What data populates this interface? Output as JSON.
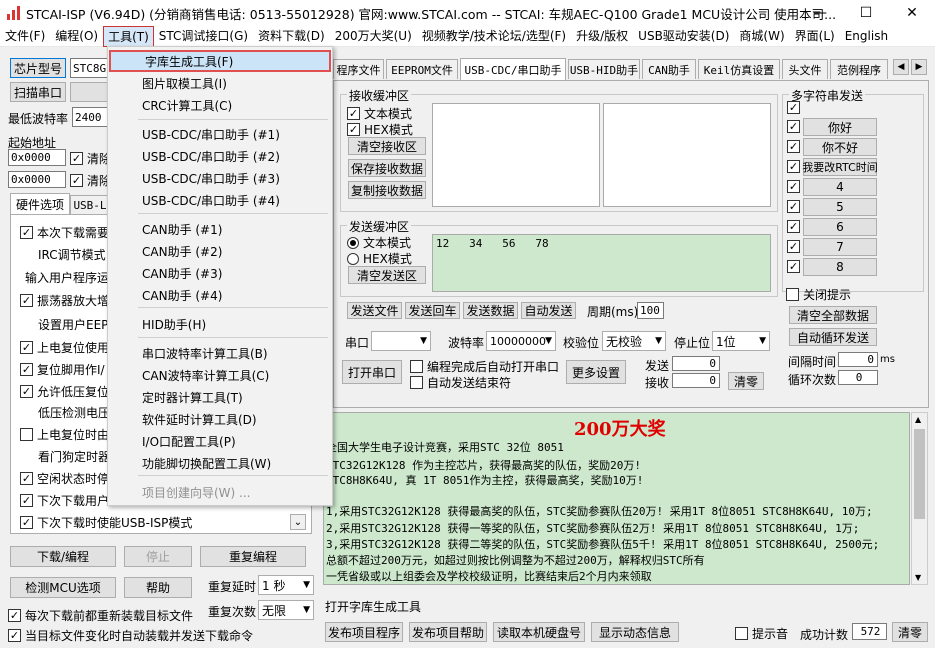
{
  "window": {
    "title": "STCAI-ISP (V6.94D) (分销商销售电话: 0513-55012928) 官网:www.STCAI.com  -- STCAI: 车规AEC-Q100 Grade1 MCU设计公司 使用本司...",
    "min": "—",
    "max": "☐",
    "close": "✕"
  },
  "menu": [
    "文件(F)",
    "编程(O)",
    "工具(T)",
    "STC调试接口(G)",
    "资料下载(D)",
    "200万大奖(U)",
    "视频教学/技术论坛/选型(F)",
    "升级/版权",
    "USB驱动安装(D)",
    "商城(W)",
    "界面(L)",
    "English"
  ],
  "left": {
    "chip_btn": "芯片型号",
    "chip_val": "STC8G",
    "scan_btn": "扫描串口",
    "min_baud_label": "最低波特率",
    "min_baud_val": "2400",
    "start_addr_label": "起始地址",
    "addr1": "0x0000",
    "clear1": "清除",
    "addr2": "0x0000",
    "clear2": "清除",
    "hw_tab": "硬件选项",
    "usb_tab": "USB-L",
    "options": [
      {
        "checked": true,
        "text": "本次下载需要"
      },
      {
        "checked": null,
        "text": "IRC调节模式"
      },
      {
        "checked": null,
        "text": "输入用户程序运"
      },
      {
        "checked": true,
        "text": "振荡器放大增"
      },
      {
        "checked": null,
        "text": "设置用户EEPR"
      },
      {
        "checked": true,
        "text": "上电复位使用"
      },
      {
        "checked": true,
        "text": "复位脚用作I/"
      },
      {
        "checked": true,
        "text": "允许低压复位"
      },
      {
        "checked": null,
        "text": "低压检测电压"
      },
      {
        "checked": false,
        "text": "上电复位时由"
      },
      {
        "checked": null,
        "text": "看门狗定时器"
      },
      {
        "checked": true,
        "text": "空闲状态时停"
      },
      {
        "checked": true,
        "text": "下次下载用户"
      },
      {
        "checked": true,
        "text": "下次下载时使能USB-ISP模式"
      }
    ],
    "download_btn": "下载/编程",
    "stop_btn": "停止",
    "reprogram_btn": "重复编程",
    "detect_btn": "检测MCU选项",
    "help_btn": "帮助",
    "repeat_delay_label": "重复延时",
    "repeat_delay_val": "1 秒",
    "repeat_count_label": "重复次数",
    "repeat_count_val": "无限",
    "reload_label": "每次下载前都重新装载目标文件",
    "auto_label": "当目标文件变化时自动装载并发送下载命令"
  },
  "dropdown": {
    "items": [
      {
        "label": "字库生成工具(F)",
        "highlight": true
      },
      {
        "label": "图片取模工具(I)"
      },
      {
        "label": "CRC计算工具(C)"
      },
      {
        "label": "USB-CDC/串口助手 (#1)"
      },
      {
        "label": "USB-CDC/串口助手 (#2)"
      },
      {
        "label": "USB-CDC/串口助手 (#3)"
      },
      {
        "label": "USB-CDC/串口助手 (#4)"
      },
      {
        "label": "CAN助手 (#1)"
      },
      {
        "label": "CAN助手 (#2)"
      },
      {
        "label": "CAN助手 (#3)"
      },
      {
        "label": "CAN助手 (#4)"
      },
      {
        "label": "HID助手(H)"
      },
      {
        "label": "串口波特率计算工具(B)"
      },
      {
        "label": "CAN波特率计算工具(C)"
      },
      {
        "label": "定时器计算工具(T)"
      },
      {
        "label": "软件延时计算工具(D)"
      },
      {
        "label": "I/O口配置工具(P)"
      },
      {
        "label": "功能脚切换配置工具(W)"
      },
      {
        "label": "项目创建向导(W) ...",
        "disabled": true
      }
    ]
  },
  "tabs": [
    "程序文件",
    "EEPROM文件",
    "USB-CDC/串口助手",
    "USB-HID助手",
    "CAN助手",
    "Keil仿真设置",
    "头文件",
    "范例程序"
  ],
  "serial": {
    "recv_group": "接收缓冲区",
    "text_mode": "文本模式",
    "hex_mode": "HEX模式",
    "clear_recv": "清空接收区",
    "save_recv": "保存接收数据",
    "copy_recv": "复制接收数据",
    "send_group": "发送缓冲区",
    "send_text_mode": "文本模式",
    "send_hex_mode": "HEX模式",
    "clear_send": "清空发送区",
    "send_content": "12   34   56   78",
    "send_file": "发送文件",
    "send_back": "发送回车",
    "send_data": "发送数据",
    "auto_send": "自动发送",
    "period_label": "周期(ms)",
    "period_val": "100",
    "port_label": "串口",
    "baud_label": "波特率",
    "baud_val": "10000000",
    "parity_label": "校验位",
    "parity_val": "无校验",
    "stop_label": "停止位",
    "stop_val": "1位",
    "open_port": "打开串口",
    "auto_open": "编程完成后自动打开串口",
    "auto_end": "自动发送结束符",
    "more_settings": "更多设置",
    "sent_label": "发送",
    "sent_val": "0",
    "recv_label": "接收",
    "recv_val": "0",
    "clear_count": "清零"
  },
  "multi": {
    "title": "多字符串发送",
    "items": [
      "你好",
      "你不好",
      "我要改RTC时间",
      "4",
      "5",
      "6",
      "7",
      "8"
    ],
    "close_hint": "关闭提示",
    "clear_all": "清空全部数据",
    "auto_loop": "自动循环发送",
    "interval_label": "间隔时间",
    "interval_val": "0",
    "interval_unit": "ms",
    "loop_label": "循环次数",
    "loop_val": "0"
  },
  "news": {
    "title": "200万大奖",
    "lines": [
      "全国大学生电子设计竞赛，采用STC 32位 8051",
      "STC32G12K128 作为主控芯片，获得最高奖的队伍，奖励20万!",
      "STC8H8K64U, 真 1T 8051作为主控，获得最高奖，奖励10万!",
      "",
      "1,采用STC32G12K128 获得最高奖的队伍，STC奖励参赛队伍20万!  采用1T 8位8051 STC8H8K64U, 10万;",
      "2,采用STC32G12K128 获得一等奖的队伍，STC奖励参赛队伍2万!  采用1T 8位8051 STC8H8K64U, 1万;",
      "3,采用STC32G12K128 获得二等奖的队伍，STC奖励参赛队伍5千!  采用1T 8位8051 STC8H8K64U, 2500元;",
      "总额不超过200万元，如超过则按比例调整为不超过200万，解释权归STC所有",
      "一凭省级或以上组委会及学校校级证明，比赛结束后2个月内来领取"
    ]
  },
  "status": {
    "text": "打开字库生成工具",
    "publish_project": "发布项目程序",
    "publish_help": "发布项目帮助",
    "read_serial": "读取本机硬盘号",
    "show_anim": "显示动态信息",
    "hint_label": "提示音",
    "success_label": "成功计数",
    "success_val": "572",
    "clear": "清零"
  }
}
